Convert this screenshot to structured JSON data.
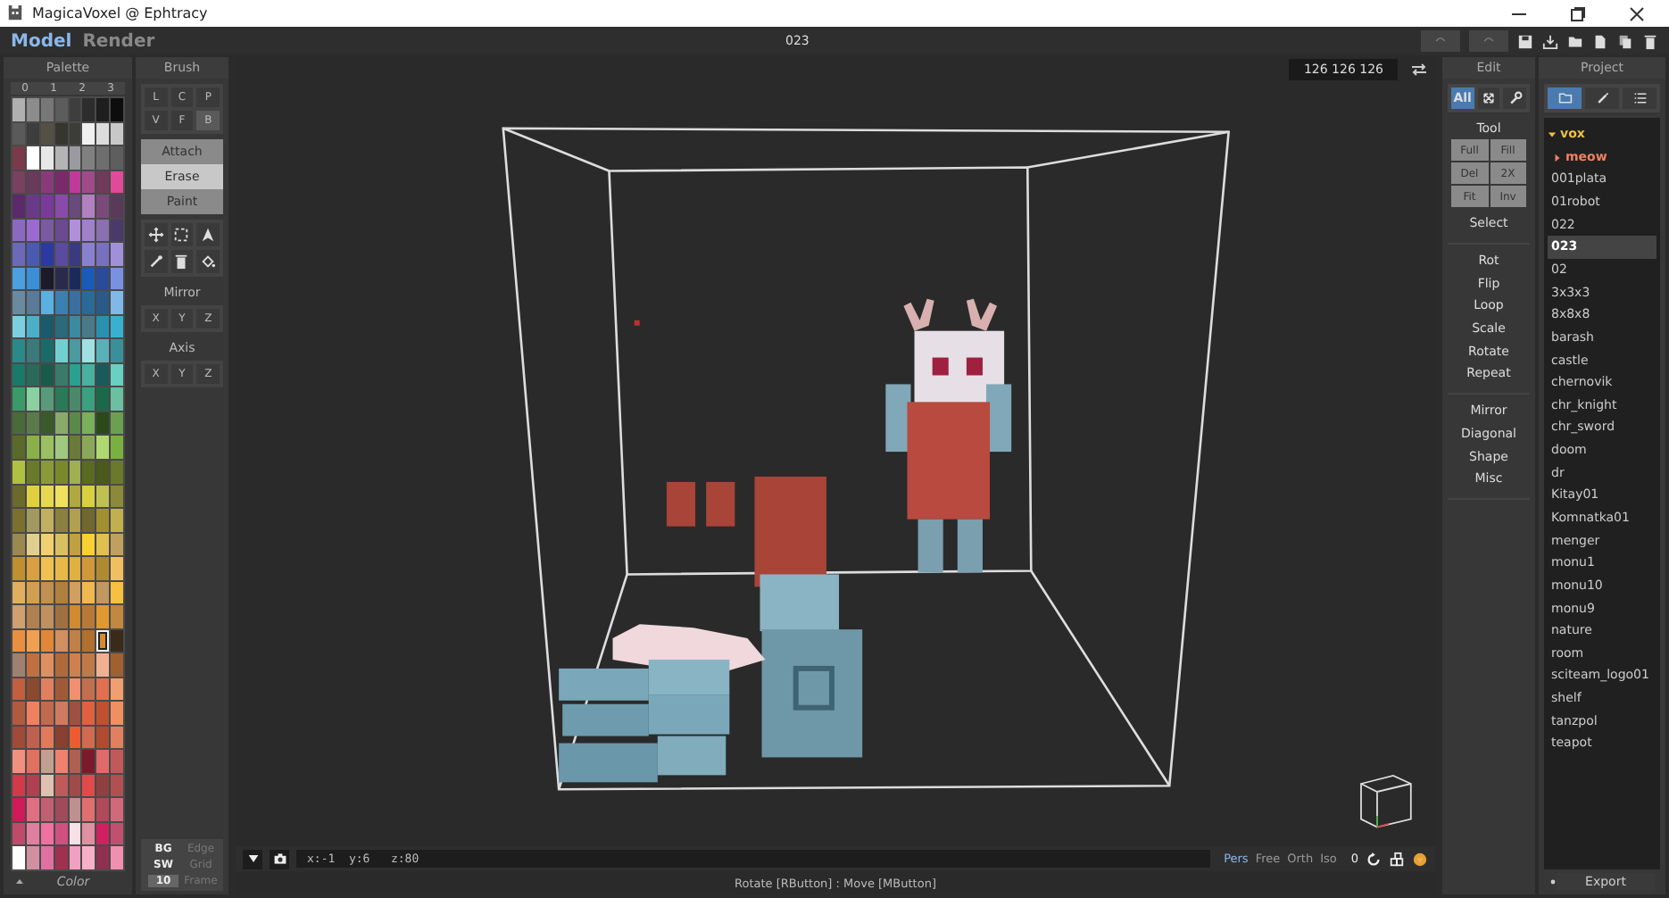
{
  "window": {
    "title": "MagicaVoxel @ Ephtracy"
  },
  "modes": [
    {
      "label": "Model",
      "selected": true
    },
    {
      "label": "Render",
      "selected": false
    }
  ],
  "document_title": "023",
  "palette": {
    "title": "Palette",
    "pages": [
      "0",
      "1",
      "2",
      "3"
    ],
    "footer": "Color",
    "rows": [
      {
        "swatches": [
          {
            "color": "#b0b0b0",
            "selected": false
          },
          {
            "color": "#8c8c8c",
            "selected": false
          },
          {
            "color": "#777777",
            "selected": false
          },
          {
            "color": "#5c5c5c",
            "selected": false
          },
          {
            "color": "#3e3e3e",
            "selected": false
          },
          {
            "color": "#2d2d2d",
            "selected": false
          },
          {
            "color": "#1e1e1e",
            "selected": false
          },
          {
            "color": "#0d0d0d",
            "selected": false
          }
        ]
      },
      {
        "swatches": [
          {
            "color": "#5a5a5a",
            "selected": false
          },
          {
            "color": "#3e3e3e",
            "selected": false
          },
          {
            "color": "#555046",
            "selected": false
          },
          {
            "color": "#36362f",
            "selected": false
          },
          {
            "color": "#3c3c38",
            "selected": false
          },
          {
            "color": "#f0f0f0",
            "selected": false
          },
          {
            "color": "#dcdcdc",
            "selected": false
          },
          {
            "color": "#c8c8c8",
            "selected": false
          }
        ]
      },
      {
        "swatches": [
          {
            "color": "#7a3a4a",
            "selected": false
          },
          {
            "color": "#ffffff",
            "selected": false
          },
          {
            "color": "#e8e8e8",
            "selected": false
          },
          {
            "color": "#b4b4b4",
            "selected": false
          },
          {
            "color": "#9a9aa0",
            "selected": false
          },
          {
            "color": "#808080",
            "selected": false
          },
          {
            "color": "#6e6e6e",
            "selected": false
          },
          {
            "color": "#5e5e5e",
            "selected": false
          }
        ]
      },
      {
        "swatches": [
          {
            "color": "#7a4060",
            "selected": false
          },
          {
            "color": "#6a3a5a",
            "selected": false
          },
          {
            "color": "#8a3a7a",
            "selected": false
          },
          {
            "color": "#7a2a6a",
            "selected": false
          },
          {
            "color": "#c03a9a",
            "selected": false
          },
          {
            "color": "#a04a8a",
            "selected": false
          },
          {
            "color": "#703a5a",
            "selected": false
          },
          {
            "color": "#e04a9a",
            "selected": false
          }
        ]
      },
      {
        "swatches": [
          {
            "color": "#5a2a6a",
            "selected": false
          },
          {
            "color": "#6a3a8a",
            "selected": false
          },
          {
            "color": "#7a3a9a",
            "selected": false
          },
          {
            "color": "#8a4aaa",
            "selected": false
          },
          {
            "color": "#6a4a7a",
            "selected": false
          },
          {
            "color": "#b080c0",
            "selected": false
          },
          {
            "color": "#7a4a7a",
            "selected": false
          },
          {
            "color": "#5a3a5a",
            "selected": false
          }
        ]
      },
      {
        "swatches": [
          {
            "color": "#8a6ac0",
            "selected": false
          },
          {
            "color": "#9a6ad0",
            "selected": false
          },
          {
            "color": "#7a5aa0",
            "selected": false
          },
          {
            "color": "#6a4a90",
            "selected": false
          },
          {
            "color": "#b090d8",
            "selected": false
          },
          {
            "color": "#a080c8",
            "selected": false
          },
          {
            "color": "#8a70b0",
            "selected": false
          },
          {
            "color": "#4a3a6a",
            "selected": false
          }
        ]
      },
      {
        "swatches": [
          {
            "color": "#6a6ab8",
            "selected": false
          },
          {
            "color": "#4a5ab0",
            "selected": false
          },
          {
            "color": "#2a3aa0",
            "selected": false
          },
          {
            "color": "#5a4aa0",
            "selected": false
          },
          {
            "color": "#3a3a80",
            "selected": false
          },
          {
            "color": "#8a80d0",
            "selected": false
          },
          {
            "color": "#7a70c0",
            "selected": false
          },
          {
            "color": "#a090d8",
            "selected": false
          }
        ]
      },
      {
        "swatches": [
          {
            "color": "#4aa0e0",
            "selected": false
          },
          {
            "color": "#3a90d8",
            "selected": false
          },
          {
            "color": "#1a1a2a",
            "selected": false
          },
          {
            "color": "#2a2a4a",
            "selected": false
          },
          {
            "color": "#1a2a5a",
            "selected": false
          },
          {
            "color": "#1a5ab8",
            "selected": false
          },
          {
            "color": "#2a4a9a",
            "selected": false
          },
          {
            "color": "#7a90e0",
            "selected": false
          }
        ]
      },
      {
        "swatches": [
          {
            "color": "#6a8aa0",
            "selected": false
          },
          {
            "color": "#5a7a98",
            "selected": false
          },
          {
            "color": "#5ab0e0",
            "selected": false
          },
          {
            "color": "#3a80b0",
            "selected": false
          },
          {
            "color": "#3a70a0",
            "selected": false
          },
          {
            "color": "#2a6a98",
            "selected": false
          },
          {
            "color": "#2a5a88",
            "selected": false
          },
          {
            "color": "#80b8e8",
            "selected": false
          }
        ]
      },
      {
        "swatches": [
          {
            "color": "#7ad0e0",
            "selected": false
          },
          {
            "color": "#4ab0c8",
            "selected": false
          },
          {
            "color": "#1a5a6a",
            "selected": false
          },
          {
            "color": "#2a6a7a",
            "selected": false
          },
          {
            "color": "#3a8aa0",
            "selected": false
          },
          {
            "color": "#4a7a8a",
            "selected": false
          },
          {
            "color": "#2a90b0",
            "selected": false
          },
          {
            "color": "#3ab0d0",
            "selected": false
          }
        ]
      },
      {
        "swatches": [
          {
            "color": "#2a8a8a",
            "selected": false
          },
          {
            "color": "#3a7a7a",
            "selected": false
          },
          {
            "color": "#1a6a6a",
            "selected": false
          },
          {
            "color": "#70d0d0",
            "selected": false
          },
          {
            "color": "#4a9aa0",
            "selected": false
          },
          {
            "color": "#a0e0e0",
            "selected": false
          },
          {
            "color": "#5ab0b8",
            "selected": false
          },
          {
            "color": "#3a9098",
            "selected": false
          }
        ]
      },
      {
        "swatches": [
          {
            "color": "#1a7a6a",
            "selected": false
          },
          {
            "color": "#2a6a5a",
            "selected": false
          },
          {
            "color": "#1a5a4a",
            "selected": false
          },
          {
            "color": "#3a7a6a",
            "selected": false
          },
          {
            "color": "#2aa090",
            "selected": false
          },
          {
            "color": "#4ab0a0",
            "selected": false
          },
          {
            "color": "#1a5a5a",
            "selected": false
          },
          {
            "color": "#6ad0c0",
            "selected": false
          }
        ]
      },
      {
        "swatches": [
          {
            "color": "#3a9a6a",
            "selected": false
          },
          {
            "color": "#8ad0a0",
            "selected": false
          },
          {
            "color": "#5a9a7a",
            "selected": false
          },
          {
            "color": "#2a7a5a",
            "selected": false
          },
          {
            "color": "#4a8a6a",
            "selected": false
          },
          {
            "color": "#3aa080",
            "selected": false
          },
          {
            "color": "#1a6a4a",
            "selected": false
          },
          {
            "color": "#6ac0a0",
            "selected": false
          }
        ]
      },
      {
        "swatches": [
          {
            "color": "#4a6a3a",
            "selected": false
          },
          {
            "color": "#5a7a4a",
            "selected": false
          },
          {
            "color": "#3a5a2a",
            "selected": false
          },
          {
            "color": "#8aaa6a",
            "selected": false
          },
          {
            "color": "#5a8a4a",
            "selected": false
          },
          {
            "color": "#7ab05a",
            "selected": false
          },
          {
            "color": "#2a4a1a",
            "selected": false
          },
          {
            "color": "#6aa050",
            "selected": false
          }
        ]
      },
      {
        "swatches": [
          {
            "color": "#5a6a2a",
            "selected": false
          },
          {
            "color": "#8ab04a",
            "selected": false
          },
          {
            "color": "#9ac060",
            "selected": false
          },
          {
            "color": "#a0c880",
            "selected": false
          },
          {
            "color": "#6a7a3a",
            "selected": false
          },
          {
            "color": "#8aa85a",
            "selected": false
          },
          {
            "color": "#b0d870",
            "selected": false
          },
          {
            "color": "#7ab040",
            "selected": false
          }
        ]
      },
      {
        "swatches": [
          {
            "color": "#b0c040",
            "selected": false
          },
          {
            "color": "#6a7a2a",
            "selected": false
          },
          {
            "color": "#8a9a3a",
            "selected": false
          },
          {
            "color": "#7a8a2a",
            "selected": false
          },
          {
            "color": "#a0b050",
            "selected": false
          },
          {
            "color": "#5a6a20",
            "selected": false
          },
          {
            "color": "#4a5a1a",
            "selected": false
          },
          {
            "color": "#6a7a2a",
            "selected": false
          }
        ]
      },
      {
        "swatches": [
          {
            "color": "#6a6a2a",
            "selected": false
          },
          {
            "color": "#e0d040",
            "selected": false
          },
          {
            "color": "#e8d850",
            "selected": false
          },
          {
            "color": "#f0e060",
            "selected": false
          },
          {
            "color": "#b0a840",
            "selected": false
          },
          {
            "color": "#d8d040",
            "selected": false
          },
          {
            "color": "#c0c050",
            "selected": false
          },
          {
            "color": "#8a8a3a",
            "selected": false
          }
        ]
      },
      {
        "swatches": [
          {
            "color": "#7a7030",
            "selected": false
          },
          {
            "color": "#a09a60",
            "selected": false
          },
          {
            "color": "#c0b060",
            "selected": false
          },
          {
            "color": "#8a8040",
            "selected": false
          },
          {
            "color": "#b0a050",
            "selected": false
          },
          {
            "color": "#706830",
            "selected": false
          },
          {
            "color": "#a09030",
            "selected": false
          },
          {
            "color": "#c0b050",
            "selected": false
          }
        ]
      },
      {
        "swatches": [
          {
            "color": "#9a8a50",
            "selected": false
          },
          {
            "color": "#e0d090",
            "selected": false
          },
          {
            "color": "#f0d070",
            "selected": false
          },
          {
            "color": "#d8c060",
            "selected": false
          },
          {
            "color": "#c0a040",
            "selected": false
          },
          {
            "color": "#f8d030",
            "selected": false
          },
          {
            "color": "#e0c050",
            "selected": false
          },
          {
            "color": "#c0a060",
            "selected": false
          }
        ]
      },
      {
        "swatches": [
          {
            "color": "#c09030",
            "selected": false
          },
          {
            "color": "#d8a040",
            "selected": false
          },
          {
            "color": "#f0c050",
            "selected": false
          },
          {
            "color": "#e8b848",
            "selected": false
          },
          {
            "color": "#e0b040",
            "selected": false
          },
          {
            "color": "#d09838",
            "selected": false
          },
          {
            "color": "#b08a30",
            "selected": false
          },
          {
            "color": "#f0c060",
            "selected": false
          }
        ]
      },
      {
        "swatches": [
          {
            "color": "#e0b060",
            "selected": false
          },
          {
            "color": "#d0a050",
            "selected": false
          },
          {
            "color": "#c09050",
            "selected": false
          },
          {
            "color": "#b08040",
            "selected": false
          },
          {
            "color": "#d0a060",
            "selected": false
          },
          {
            "color": "#f0b850",
            "selected": false
          },
          {
            "color": "#c09860",
            "selected": false
          },
          {
            "color": "#f8c040",
            "selected": false
          }
        ]
      },
      {
        "swatches": [
          {
            "color": "#d0a070",
            "selected": false
          },
          {
            "color": "#b08050",
            "selected": false
          },
          {
            "color": "#c09060",
            "selected": false
          },
          {
            "color": "#a07040",
            "selected": false
          },
          {
            "color": "#d08a30",
            "selected": false
          },
          {
            "color": "#b87838",
            "selected": false
          },
          {
            "color": "#e09830",
            "selected": false
          },
          {
            "color": "#c08840",
            "selected": false
          }
        ]
      },
      {
        "swatches": [
          {
            "color": "#e89040",
            "selected": false
          },
          {
            "color": "#f0a050",
            "selected": false
          },
          {
            "color": "#e08838",
            "selected": false
          },
          {
            "color": "#d09060",
            "selected": false
          },
          {
            "color": "#c08048",
            "selected": false
          },
          {
            "color": "#b07030",
            "selected": false
          },
          {
            "color": "#d88a30",
            "selected": true
          },
          {
            "color": "#3a2a1a",
            "selected": false
          }
        ]
      },
      {
        "swatches": [
          {
            "color": "#a08070",
            "selected": false
          },
          {
            "color": "#c07040",
            "selected": false
          },
          {
            "color": "#e09060",
            "selected": false
          },
          {
            "color": "#b06a3a",
            "selected": false
          },
          {
            "color": "#d08050",
            "selected": false
          },
          {
            "color": "#c07a48",
            "selected": false
          },
          {
            "color": "#f0b090",
            "selected": false
          },
          {
            "color": "#a06030",
            "selected": false
          }
        ]
      },
      {
        "swatches": [
          {
            "color": "#c06040",
            "selected": false
          },
          {
            "color": "#8a4a30",
            "selected": false
          },
          {
            "color": "#e08060",
            "selected": false
          },
          {
            "color": "#a05a3a",
            "selected": false
          },
          {
            "color": "#f09070",
            "selected": false
          },
          {
            "color": "#c07050",
            "selected": false
          },
          {
            "color": "#e07050",
            "selected": false
          },
          {
            "color": "#f0a070",
            "selected": false
          }
        ]
      },
      {
        "swatches": [
          {
            "color": "#b05a40",
            "selected": false
          },
          {
            "color": "#f08060",
            "selected": false
          },
          {
            "color": "#c06a50",
            "selected": false
          },
          {
            "color": "#d07a60",
            "selected": false
          },
          {
            "color": "#a05040",
            "selected": false
          },
          {
            "color": "#e06040",
            "selected": false
          },
          {
            "color": "#c05030",
            "selected": false
          },
          {
            "color": "#f09060",
            "selected": false
          }
        ]
      },
      {
        "swatches": [
          {
            "color": "#a04a3a",
            "selected": false
          },
          {
            "color": "#c06050",
            "selected": false
          },
          {
            "color": "#e07a5a",
            "selected": false
          },
          {
            "color": "#8a4030",
            "selected": false
          },
          {
            "color": "#f05a30",
            "selected": false
          },
          {
            "color": "#d06a50",
            "selected": false
          },
          {
            "color": "#b04a30",
            "selected": false
          },
          {
            "color": "#e08060",
            "selected": false
          }
        ]
      },
      {
        "swatches": [
          {
            "color": "#f09080",
            "selected": false
          },
          {
            "color": "#e07060",
            "selected": false
          },
          {
            "color": "#c0a090",
            "selected": false
          },
          {
            "color": "#f08070",
            "selected": false
          },
          {
            "color": "#b06050",
            "selected": false
          },
          {
            "color": "#7a1a2a",
            "selected": false
          },
          {
            "color": "#e06a6a",
            "selected": false
          },
          {
            "color": "#c05a5a",
            "selected": false
          }
        ]
      },
      {
        "swatches": [
          {
            "color": "#d03a4a",
            "selected": false
          },
          {
            "color": "#b04050",
            "selected": false
          },
          {
            "color": "#e0c0b0",
            "selected": false
          },
          {
            "color": "#c05a5a",
            "selected": false
          },
          {
            "color": "#a04a4a",
            "selected": false
          },
          {
            "color": "#e04a4a",
            "selected": false
          },
          {
            "color": "#904040",
            "selected": false
          },
          {
            "color": "#b05050",
            "selected": false
          }
        ]
      },
      {
        "swatches": [
          {
            "color": "#d01a5a",
            "selected": false
          },
          {
            "color": "#e07080",
            "selected": false
          },
          {
            "color": "#c06070",
            "selected": false
          },
          {
            "color": "#a04a5a",
            "selected": false
          },
          {
            "color": "#c09090",
            "selected": false
          },
          {
            "color": "#e07070",
            "selected": false
          },
          {
            "color": "#b04a5a",
            "selected": false
          },
          {
            "color": "#d06a7a",
            "selected": false
          }
        ]
      },
      {
        "swatches": [
          {
            "color": "#c04a6a",
            "selected": false
          },
          {
            "color": "#e080a0",
            "selected": false
          },
          {
            "color": "#f070a0",
            "selected": false
          },
          {
            "color": "#d05080",
            "selected": false
          },
          {
            "color": "#f8e0e8",
            "selected": false
          },
          {
            "color": "#e090a0",
            "selected": false
          },
          {
            "color": "#d02060",
            "selected": false
          },
          {
            "color": "#c05070",
            "selected": false
          }
        ]
      },
      {
        "swatches": [
          {
            "color": "#ffffff",
            "selected": false
          },
          {
            "color": "#d090a0",
            "selected": false
          },
          {
            "color": "#e070a0",
            "selected": false
          },
          {
            "color": "#a03050",
            "selected": false
          },
          {
            "color": "#f0a0c0",
            "selected": false
          },
          {
            "color": "#f8b0c8",
            "selected": false
          },
          {
            "color": "#903050",
            "selected": false
          },
          {
            "color": "#f090b0",
            "selected": false
          }
        ]
      }
    ]
  },
  "brush": {
    "title": "Brush",
    "types": [
      {
        "label": "L",
        "selected": false
      },
      {
        "label": "C",
        "selected": false
      },
      {
        "label": "P",
        "selected": false
      },
      {
        "label": "V",
        "selected": false
      },
      {
        "label": "F",
        "selected": false
      },
      {
        "label": "B",
        "selected": true
      }
    ],
    "modes": [
      {
        "label": "Attach",
        "selected": false
      },
      {
        "label": "Erase",
        "selected": true
      },
      {
        "label": "Paint",
        "selected": false
      }
    ],
    "mirror": {
      "title": "Mirror",
      "axes": [
        "X",
        "Y",
        "Z"
      ]
    },
    "axis": {
      "title": "Axis",
      "axes": [
        "X",
        "Y",
        "Z"
      ]
    }
  },
  "display": [
    {
      "kind": "toggle",
      "label": "BG",
      "on": true
    },
    {
      "kind": "toggle",
      "label": "Edge",
      "on": false
    },
    {
      "kind": "toggle",
      "label": "SW",
      "on": true
    },
    {
      "kind": "toggle",
      "label": "Grid",
      "on": false
    },
    {
      "kind": "field",
      "label": "10"
    },
    {
      "kind": "toggle",
      "label": "Frame",
      "on": false
    }
  ],
  "viewport": {
    "color_readout": "126 126 126",
    "coordinates": "x:-1  y:6   z:80",
    "projections": [
      {
        "label": "Pers",
        "selected": true
      },
      {
        "label": "Free",
        "selected": false
      },
      {
        "label": "Orth",
        "selected": false
      },
      {
        "label": "Iso",
        "selected": false
      }
    ],
    "frame_number": "0"
  },
  "status_bar": "Rotate [RButton] : Move [MButton]",
  "edit": {
    "title": "Edit",
    "tabs": [
      {
        "kind": "text",
        "label": "All",
        "selected": true
      },
      {
        "kind": "arrows",
        "selected": false
      },
      {
        "kind": "wrench",
        "selected": false
      }
    ],
    "tool": {
      "title": "Tool",
      "buttons": [
        "Full",
        "Fill",
        "Del",
        "2X",
        "Fit",
        "Inv"
      ]
    },
    "groups": [
      [
        "Select"
      ],
      [
        "Rot",
        "Flip",
        "Loop",
        "Scale",
        "Rotate",
        "Repeat"
      ],
      [
        "Mirror",
        "Diagonal",
        "Shape",
        "Misc"
      ]
    ]
  },
  "project": {
    "title": "Project",
    "tabs": [
      {
        "kind": "folder",
        "selected": true
      },
      {
        "kind": "brush",
        "selected": false
      },
      {
        "kind": "list",
        "selected": false
      }
    ],
    "tree": [
      {
        "label": "vox",
        "expanded": true,
        "children": [
          {
            "label": "meow",
            "expanded": false
          }
        ]
      }
    ],
    "files": [
      {
        "label": "001plata",
        "selected": false
      },
      {
        "label": "01robot",
        "selected": false
      },
      {
        "label": "022",
        "selected": false
      },
      {
        "label": "023",
        "selected": true
      },
      {
        "label": "02",
        "selected": false
      },
      {
        "label": "3x3x3",
        "selected": false
      },
      {
        "label": "8x8x8",
        "selected": false
      },
      {
        "label": "barash",
        "selected": false
      },
      {
        "label": "castle",
        "selected": false
      },
      {
        "label": "chernovik",
        "selected": false
      },
      {
        "label": "chr_knight",
        "selected": false
      },
      {
        "label": "chr_sword",
        "selected": false
      },
      {
        "label": "doom",
        "selected": false
      },
      {
        "label": "dr",
        "selected": false
      },
      {
        "label": "Kitay01",
        "selected": false
      },
      {
        "label": "Komnatka01",
        "selected": false
      },
      {
        "label": "menger",
        "selected": false
      },
      {
        "label": "monu1",
        "selected": false
      },
      {
        "label": "monu10",
        "selected": false
      },
      {
        "label": "monu9",
        "selected": false
      },
      {
        "label": "nature",
        "selected": false
      },
      {
        "label": "room",
        "selected": false
      },
      {
        "label": "sciteam_logo01",
        "selected": false
      },
      {
        "label": "shelf",
        "selected": false
      },
      {
        "label": "tanzpol",
        "selected": false
      },
      {
        "label": "teapot",
        "selected": false
      }
    ],
    "footer": "Export"
  }
}
